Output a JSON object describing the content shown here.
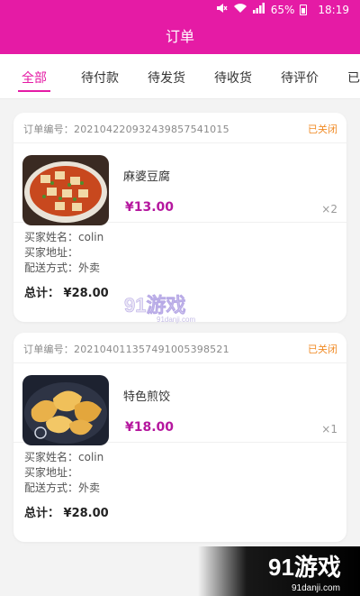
{
  "status_bar": {
    "battery": "65%",
    "time": "18:19"
  },
  "header": {
    "title": "订单"
  },
  "tabs": [
    {
      "label": "全部"
    },
    {
      "label": "待付款"
    },
    {
      "label": "待发货"
    },
    {
      "label": "待收货"
    },
    {
      "label": "待评价"
    },
    {
      "label": "已"
    }
  ],
  "orders": [
    {
      "order_no": "订单编号：20210422093243985754101​5",
      "status": "已关闭",
      "goods_name": "麻婆豆腐",
      "price": "¥13.00",
      "qty": "×2",
      "buyer_name": "买家姓名：colin",
      "buyer_address": "买家地址：",
      "delivery": "配送方式：外卖",
      "total": "总计： ¥28.00"
    },
    {
      "order_no": "订单编号：20210401135749100539852​1",
      "status": "已关闭",
      "goods_name": "特色煎饺",
      "price": "¥18.00",
      "qty": "×1",
      "buyer_name": "买家姓名：colin",
      "buyer_address": "买家地址：",
      "delivery": "配送方式：外卖",
      "total": "总计： ¥28.00"
    }
  ],
  "watermark": {
    "text": "91游戏",
    "sub": "91danji.com"
  },
  "colors": {
    "brand": "#e51ba5",
    "price": "#b5179e",
    "closed_status": "#f08a24"
  }
}
